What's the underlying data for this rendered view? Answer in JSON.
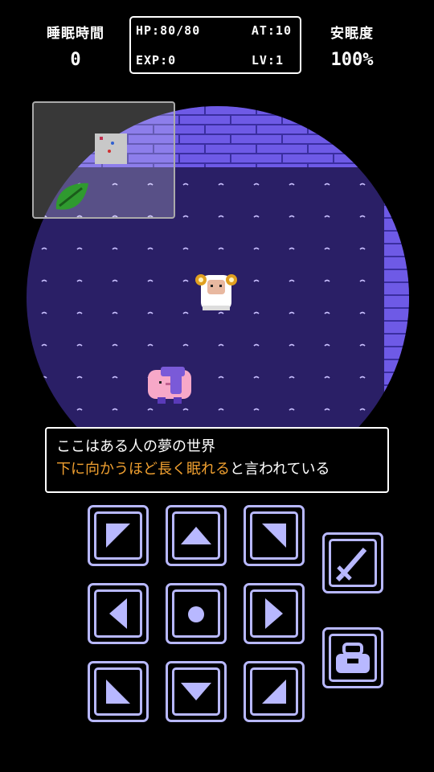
{
  "hud": {
    "sleep_time_label": "睡眠時間",
    "sleep_time_value": "0",
    "hp": "HP:80/80",
    "at": "AT:10",
    "exp": "EXP:0",
    "lv": "LV:1",
    "comfort_label": "安眠度",
    "comfort_value": "100%"
  },
  "dialog": {
    "line1": "ここはある人の夢の世界",
    "line2_highlight": "下に向かうほど長く眠れる",
    "line2_rest": "と言われている"
  },
  "colors": {
    "floor": "#2a1f66",
    "brick": "#6e5ae6",
    "highlight_text": "#f0a030",
    "button_outline": "#b8b8ff"
  },
  "controls": {
    "dpad": [
      "up-left",
      "up",
      "up-right",
      "left",
      "wait",
      "right",
      "down-left",
      "down",
      "down-right"
    ],
    "attack_icon": "sword-icon",
    "item_icon": "bag-icon"
  }
}
